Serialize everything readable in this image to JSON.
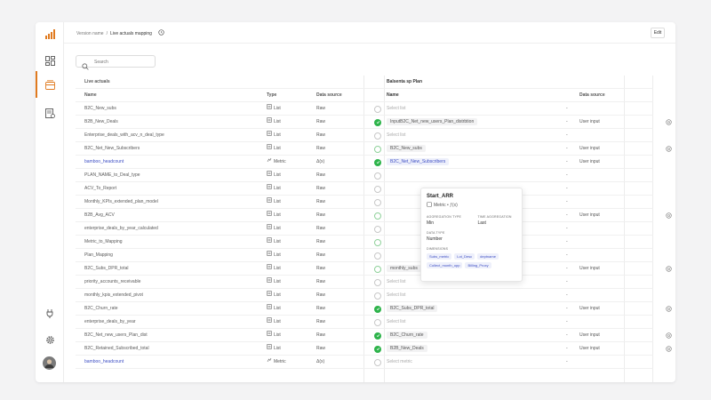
{
  "header": {
    "breadcrumb_version": "Version name",
    "breadcrumb_sep": "/",
    "breadcrumb_current": "Live actuals mapping",
    "edit_label": "Edit"
  },
  "search": {
    "placeholder": "Search"
  },
  "table": {
    "left_title": "Live actuals",
    "right_title": "Balsenta sp Plan",
    "columns": {
      "name": "Name",
      "type": "Type",
      "data_source": "Data source",
      "bname": "Name",
      "bsource": "Data source"
    },
    "rows": [
      {
        "name": "B2C_New_subs",
        "type": "List",
        "ds": "Raw",
        "status": "gray",
        "target": "Select list",
        "placeholder": true,
        "src": "",
        "action": false
      },
      {
        "name": "B2B_New_Deals",
        "type": "List",
        "ds": "Raw",
        "status": "green",
        "target": "InputB2C_Net_new_users_Plan_distrbtion",
        "placeholder": false,
        "src": "User input",
        "action": true
      },
      {
        "name": "Enterprise_deals_with_acv_n_deal_type",
        "type": "List",
        "ds": "Raw",
        "status": "gray",
        "target": "Select list",
        "placeholder": true,
        "src": "",
        "action": false
      },
      {
        "name": "B2C_Net_New_Subscribers",
        "type": "List",
        "ds": "Raw",
        "status": "ring",
        "target": "B2C_New_subs",
        "placeholder": false,
        "src": "User input",
        "action": true
      },
      {
        "name": "bamboo_headcount",
        "type": "Metric",
        "ds": "Δ(x)",
        "status": "green",
        "target": "B2C_Net_New_Subscribers",
        "placeholder": false,
        "highlight": true,
        "src": "User input",
        "action": false
      },
      {
        "name": "PLAN_NAME_to_Deal_type",
        "type": "List",
        "ds": "Raw",
        "status": "gray",
        "target": "",
        "placeholder": false,
        "src": "",
        "action": false
      },
      {
        "name": "ACV_To_Report",
        "type": "List",
        "ds": "Raw",
        "status": "gray",
        "target": "",
        "placeholder": false,
        "src": "",
        "action": false
      },
      {
        "name": "Monthly_KPIs_extended_plan_model",
        "type": "List",
        "ds": "Raw",
        "status": "gray",
        "target": "",
        "placeholder": false,
        "src": "",
        "action": false
      },
      {
        "name": "B2B_Avg_ACV",
        "type": "List",
        "ds": "Raw",
        "status": "ring",
        "target": "",
        "placeholder": false,
        "src": "User input",
        "action": true
      },
      {
        "name": "enterprise_deals_by_year_calculated",
        "type": "List",
        "ds": "Raw",
        "status": "gray",
        "target": "",
        "placeholder": false,
        "src": "",
        "action": false
      },
      {
        "name": "Metric_to_Mapping",
        "type": "List",
        "ds": "Raw",
        "status": "ring",
        "target": "",
        "placeholder": false,
        "src": "",
        "action": false
      },
      {
        "name": "Plan_Mapping",
        "type": "List",
        "ds": "Raw",
        "status": "gray",
        "target": "",
        "placeholder": false,
        "src": "",
        "action": false
      },
      {
        "name": "B2C_Subs_DPR_total",
        "type": "List",
        "ds": "Raw",
        "status": "ring",
        "target": "monthly_subs",
        "placeholder": false,
        "src": "User input",
        "action": true
      },
      {
        "name": "priority_accounts_receivable",
        "type": "List",
        "ds": "Raw",
        "status": "gray",
        "target": "Select list",
        "placeholder": true,
        "src": "",
        "action": false
      },
      {
        "name": "monthly_kpis_extended_pivot",
        "type": "List",
        "ds": "Raw",
        "status": "gray",
        "target": "Select list",
        "placeholder": true,
        "src": "",
        "action": false
      },
      {
        "name": "B2C_Churn_rate",
        "type": "List",
        "ds": "Raw",
        "status": "green",
        "target": "B2C_Subs_DPR_total",
        "placeholder": false,
        "src": "User input",
        "action": true
      },
      {
        "name": "enterprise_deals_by_year",
        "type": "List",
        "ds": "Raw",
        "status": "gray",
        "target": "Select list",
        "placeholder": true,
        "src": "",
        "action": false
      },
      {
        "name": "B2C_Net_new_users_Plan_dist",
        "type": "List",
        "ds": "Raw",
        "status": "green",
        "target": "B2C_Churn_rate",
        "placeholder": false,
        "src": "User input",
        "action": true
      },
      {
        "name": "B2C_Retained_Subscribed_total",
        "type": "List",
        "ds": "Raw",
        "status": "green",
        "target": "B2B_New_Deals",
        "placeholder": false,
        "src": "User input",
        "action": true
      },
      {
        "name": "bamboo_headcount",
        "type": "Metric",
        "ds": "Δ(x)",
        "status": "gray",
        "target": "Select metric",
        "placeholder": true,
        "src": "",
        "action": false
      }
    ]
  },
  "popup": {
    "title": "Start_ARR",
    "subtitle": "Metric • ƒ(x)",
    "agg_label": "AGGREGATION TYPE",
    "agg_value": "Min",
    "time_label": "TIME AGGREGATION",
    "time_value": "Last",
    "dtype_label": "DATA TYPE",
    "dtype_value": "Number",
    "dims_label": "DIMENSIONS",
    "dims": [
      "Subs_metric",
      "Lot_Desc",
      "deptname",
      "Collect_month_opp",
      "Billing_Proxy"
    ]
  },
  "colors": {
    "accent": "#e07a1f",
    "link": "#3d4ec4",
    "green": "#2db34a"
  }
}
